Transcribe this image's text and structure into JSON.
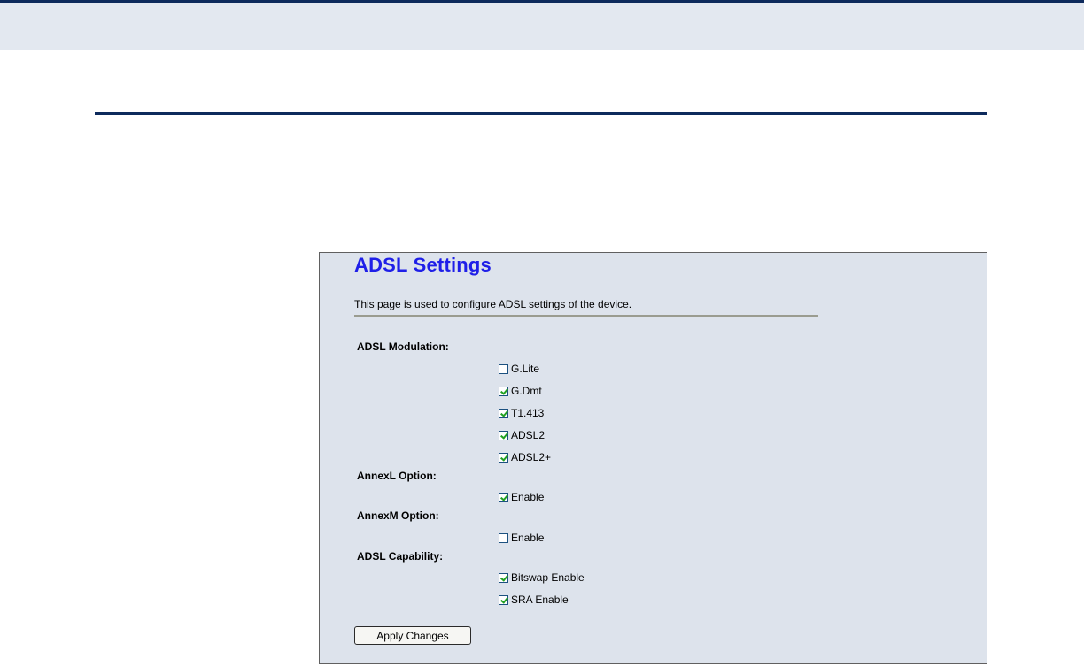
{
  "page": {
    "title": "ADSL Settings",
    "description": "This page is used to configure ADSL settings of the device."
  },
  "groups": [
    {
      "label": "ADSL Modulation:",
      "options": [
        {
          "label": "G.Lite",
          "checked": false
        },
        {
          "label": "G.Dmt",
          "checked": true
        },
        {
          "label": "T1.413",
          "checked": true
        },
        {
          "label": "ADSL2",
          "checked": true
        },
        {
          "label": "ADSL2+",
          "checked": true
        }
      ]
    },
    {
      "label": "AnnexL Option:",
      "options": [
        {
          "label": "Enable",
          "checked": true
        }
      ]
    },
    {
      "label": "AnnexM Option:",
      "options": [
        {
          "label": "Enable",
          "checked": false
        }
      ]
    },
    {
      "label": "ADSL Capability:",
      "options": [
        {
          "label": "Bitswap Enable",
          "checked": true
        },
        {
          "label": "SRA Enable",
          "checked": true
        }
      ]
    }
  ],
  "actions": {
    "apply_label": "Apply Changes"
  },
  "colors": {
    "title": "#1f1fe8",
    "panel_bg": "#dde3ec",
    "rule": "#0d2a5c",
    "check": "#21a121"
  }
}
